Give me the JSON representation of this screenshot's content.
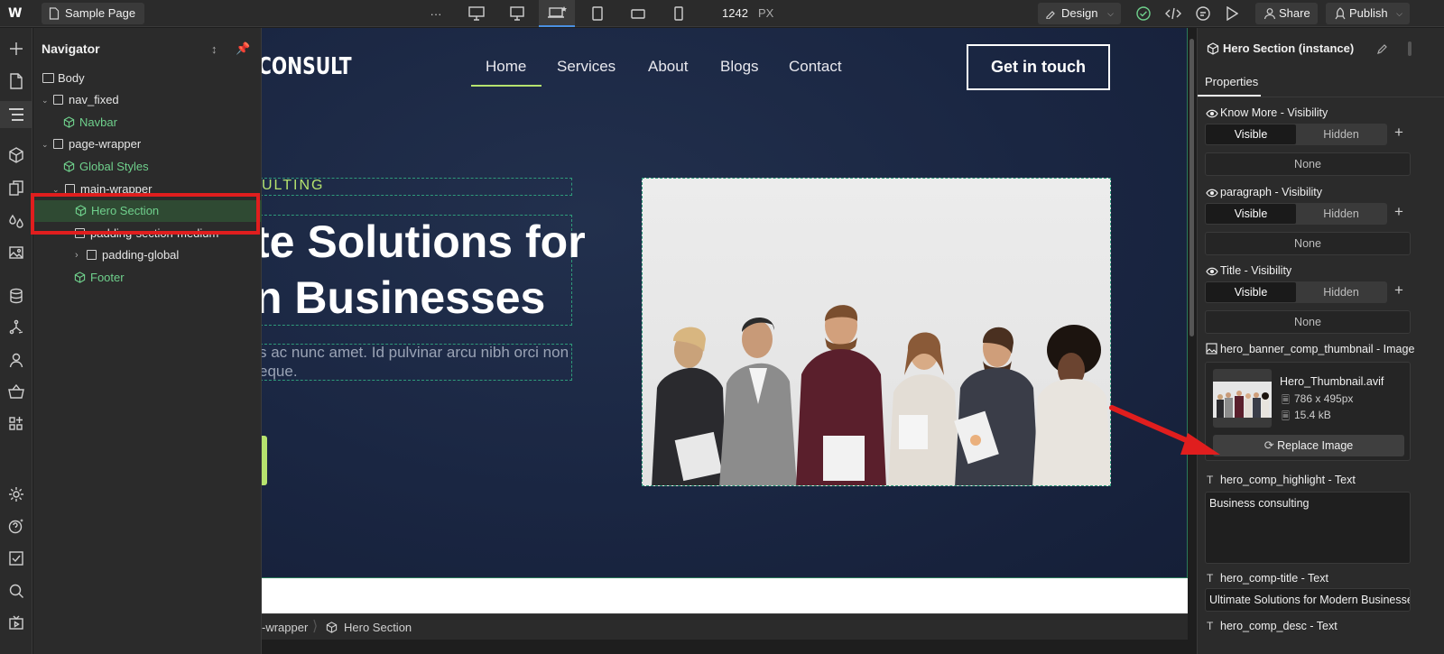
{
  "topbar": {
    "page_name": "Sample Page",
    "more": "···",
    "width_value": "1242",
    "width_unit": "PX",
    "mode_label": "Design",
    "share_label": "Share",
    "publish_label": "Publish"
  },
  "navigator": {
    "title": "Navigator",
    "items": [
      {
        "label": "Body"
      },
      {
        "label": "nav_fixed"
      },
      {
        "label": "Navbar"
      },
      {
        "label": "page-wrapper"
      },
      {
        "label": "Global Styles"
      },
      {
        "label": "main-wrapper"
      },
      {
        "label": "Hero Section"
      },
      {
        "label": "padding-section-medium"
      },
      {
        "label": "padding-global"
      },
      {
        "label": "Footer"
      }
    ]
  },
  "canvas": {
    "brand": "CONSULT",
    "menu": [
      "Home",
      "Services",
      "About",
      "Blogs",
      "Contact"
    ],
    "cta": "Get in touch",
    "highlight": "ULTING",
    "heading_line1": "te Solutions for",
    "heading_line2": "n Businesses",
    "desc_line1": "s ac nunc amet. Id pulvinar arcu nibh orci non",
    "desc_line2": "eque."
  },
  "breadcrumb": {
    "items": [
      "-wrapper",
      "Hero Section"
    ]
  },
  "properties": {
    "title": "Hero Section (instance)",
    "tab": "Properties",
    "visibility_groups": [
      {
        "label": "Know More - Visibility",
        "on": "Visible",
        "off": "Hidden",
        "value": "None"
      },
      {
        "label": "paragraph - Visibility",
        "on": "Visible",
        "off": "Hidden",
        "value": "None"
      },
      {
        "label": "Title - Visibility",
        "on": "Visible",
        "off": "Hidden",
        "value": "None"
      }
    ],
    "image_prop_label": "hero_banner_comp_thumbnail - Image",
    "image_file": "Hero_Thumbnail.avif",
    "image_dims": "786 x 495px",
    "image_size": "15.4 kB",
    "replace_label": "Replace Image",
    "highlight_label": "hero_comp_highlight - Text",
    "highlight_value": "Business consulting",
    "title_label": "hero_comp-title - Text",
    "title_value": "Ultimate Solutions for Modern Businesses",
    "desc_label": "hero_comp_desc - Text"
  },
  "colors": {
    "accent_green": "#6fd08c",
    "lime": "#b6e36e",
    "annotation_red": "#e01e1e"
  }
}
